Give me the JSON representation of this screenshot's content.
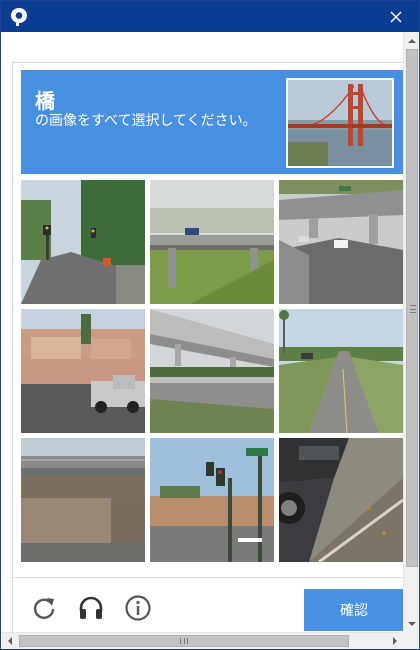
{
  "window": {
    "title": ""
  },
  "captcha": {
    "target_word": "橋",
    "instruction": "の画像をすべて選択してください。",
    "verify_label": "確認",
    "grid_rows": 3,
    "grid_cols": 3,
    "tiles": [
      {
        "name": "tile-1",
        "scene": "tree-lined road with traffic light"
      },
      {
        "name": "tile-2",
        "scene": "highway overpass bridge over grass"
      },
      {
        "name": "tile-3",
        "scene": "freeway interchange overpass"
      },
      {
        "name": "tile-4",
        "scene": "houses with parked pickup truck"
      },
      {
        "name": "tile-5",
        "scene": "concrete overpass over road"
      },
      {
        "name": "tile-6",
        "scene": "straight road with palm trees"
      },
      {
        "name": "tile-7",
        "scene": "underside of overpass"
      },
      {
        "name": "tile-8",
        "scene": "intersection with traffic signals"
      },
      {
        "name": "tile-9",
        "scene": "close-up of parked car and curb"
      }
    ]
  },
  "colors": {
    "titlebar": "#0a3d91",
    "header": "#4a90e2",
    "verify_button": "#4a90e2"
  },
  "icons": [
    "app-logo-icon",
    "close-icon",
    "reload-icon",
    "audio-icon",
    "info-icon"
  ]
}
